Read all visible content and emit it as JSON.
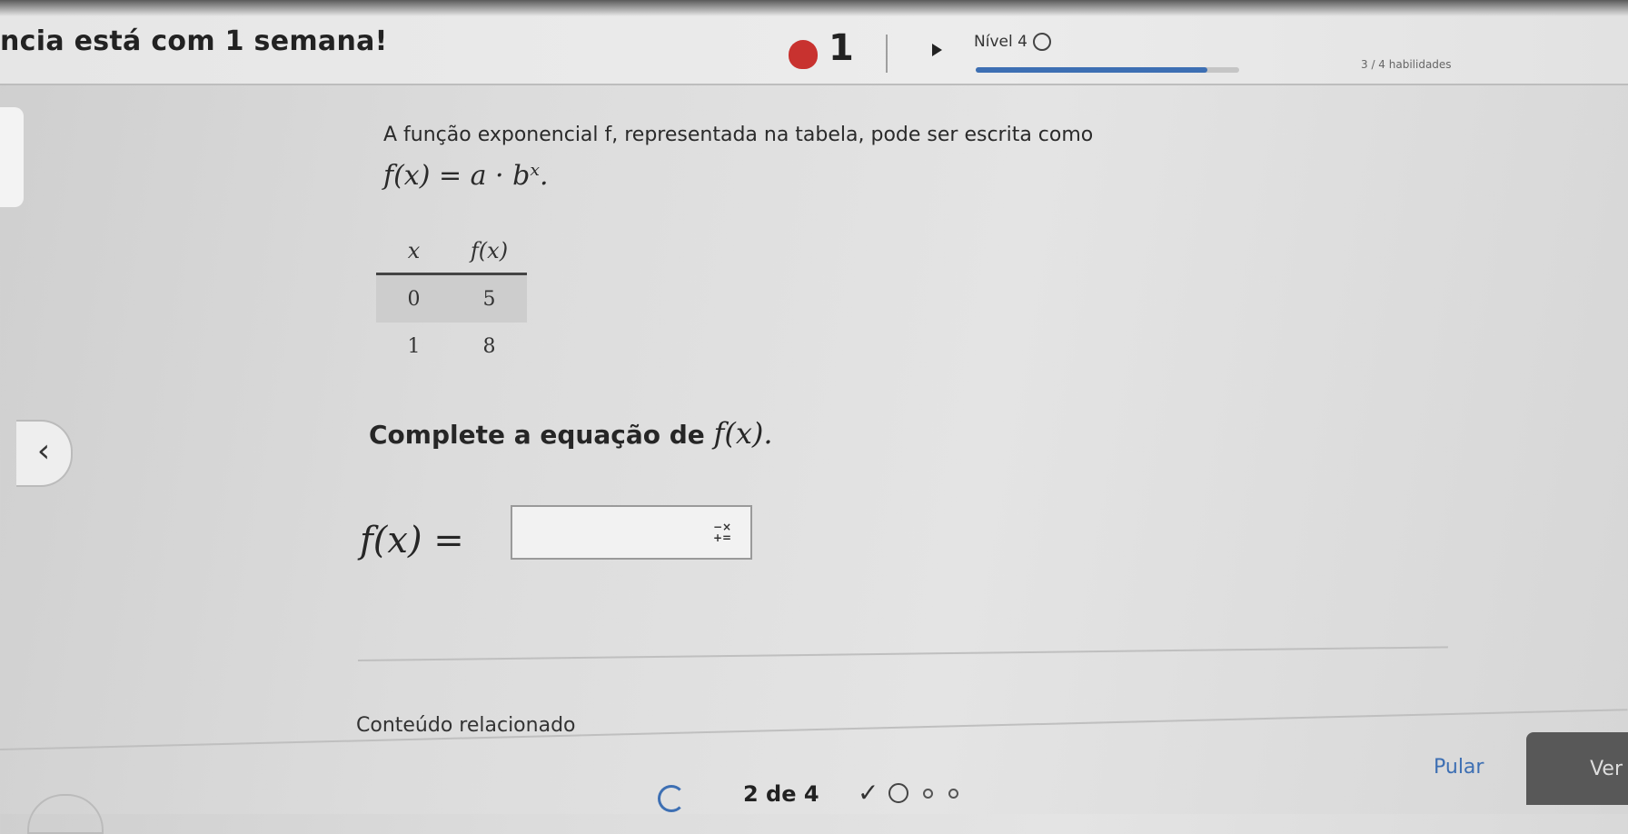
{
  "header": {
    "streak_text": "ncia está com 1 semana!",
    "streak_count": "1",
    "level_label": "Nível 4",
    "progress": 0.88,
    "progress_label": "3 / 4 habilidades"
  },
  "problem": {
    "prompt": "A função exponencial f, representada na tabela, pode ser escrita como",
    "formula": "f(x) = a · bˣ.",
    "table": {
      "headers": [
        "x",
        "f(x)"
      ],
      "rows": [
        [
          "0",
          "5"
        ],
        [
          "1",
          "8"
        ]
      ]
    },
    "instruction": "Complete a equação de ",
    "instruction_fx": "f(x).",
    "answer_label": "f(x) =",
    "answer_value": "",
    "keypad_symbol": "−× +="
  },
  "footer": {
    "related_label": "Conteúdo relacionado",
    "pager": "2 de 4",
    "skip_label": "Pular",
    "verify_label": "Ver"
  },
  "colors": {
    "accent": "#3d6fb3",
    "streak_fire": "#c8322f"
  }
}
